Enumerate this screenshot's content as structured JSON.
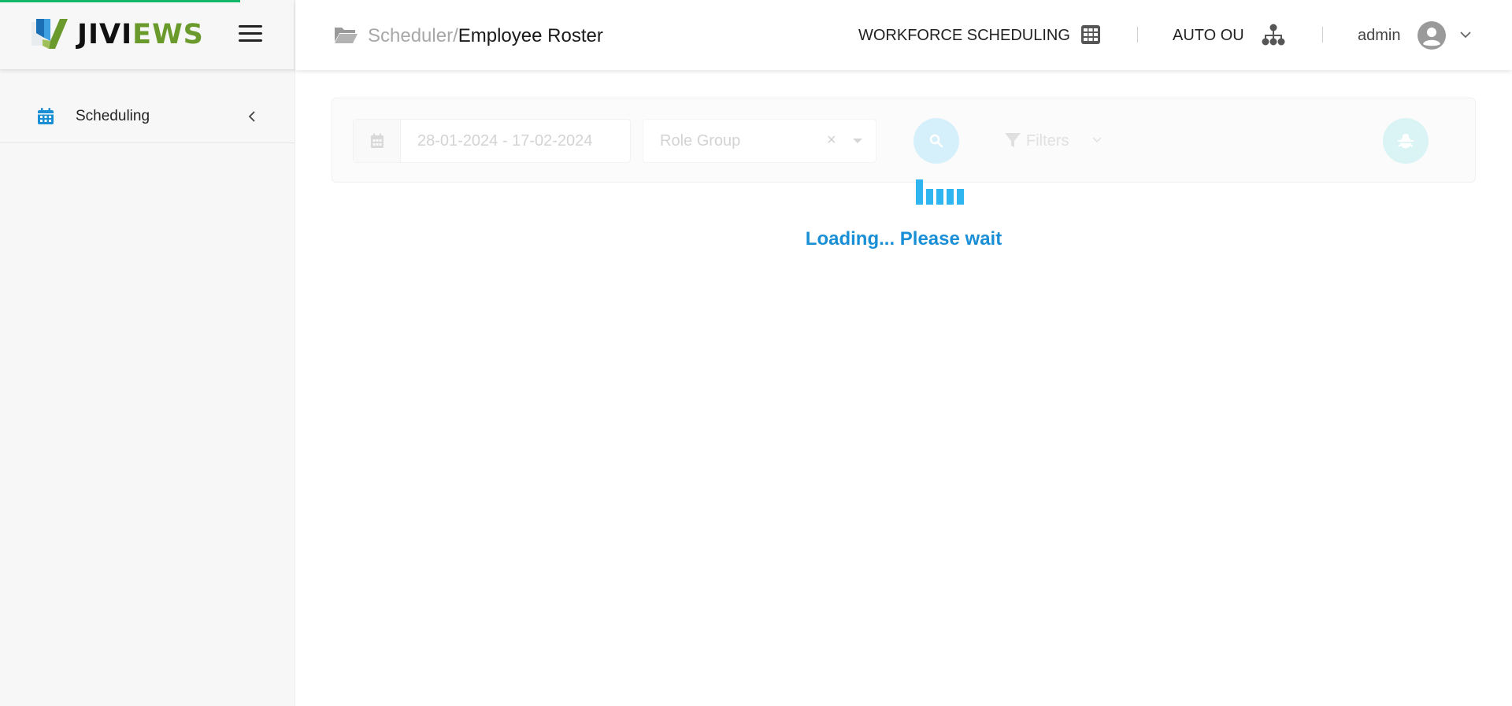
{
  "brand": {
    "name_part1": "JIVI",
    "name_part2": "EWS",
    "logo_icon": "jiviews-logo-mark",
    "accent_green": "#6a9a2c",
    "progress_color": "#12b76a"
  },
  "sidebar": {
    "menu_icon": "hamburger-icon",
    "items": [
      {
        "label": "Scheduling",
        "icon": "calendar-icon",
        "chevron": "chevron-left-icon",
        "icon_color": "#1a8fd6"
      }
    ]
  },
  "header": {
    "breadcrumb": {
      "icon": "folder-open-icon",
      "parent": "Scheduler",
      "separator": "/",
      "current": "Employee Roster"
    },
    "module_label": "WORKFORCE SCHEDULING",
    "module_icon": "grid-icon",
    "ou_label": "AUTO OU",
    "ou_icon": "org-chart-icon",
    "user_label": "admin",
    "user_icon": "user-avatar-icon",
    "user_menu_icon": "chevron-down-icon"
  },
  "filters": {
    "date_range": {
      "icon": "calendar-icon",
      "value": "28-01-2024 - 17-02-2024"
    },
    "role_group": {
      "placeholder": "Role Group",
      "clear_symbol": "×",
      "caret_icon": "caret-down-icon"
    },
    "search_icon": "search-icon",
    "filters_label": "Filters",
    "filters_icon": "filter-icon",
    "filters_caret_icon": "chevron-down-icon",
    "action_icon": "bug-icon"
  },
  "loading": {
    "text": "Loading... Please wait",
    "color": "#1a8fd6",
    "spinner_color": "#2fb6f0"
  }
}
